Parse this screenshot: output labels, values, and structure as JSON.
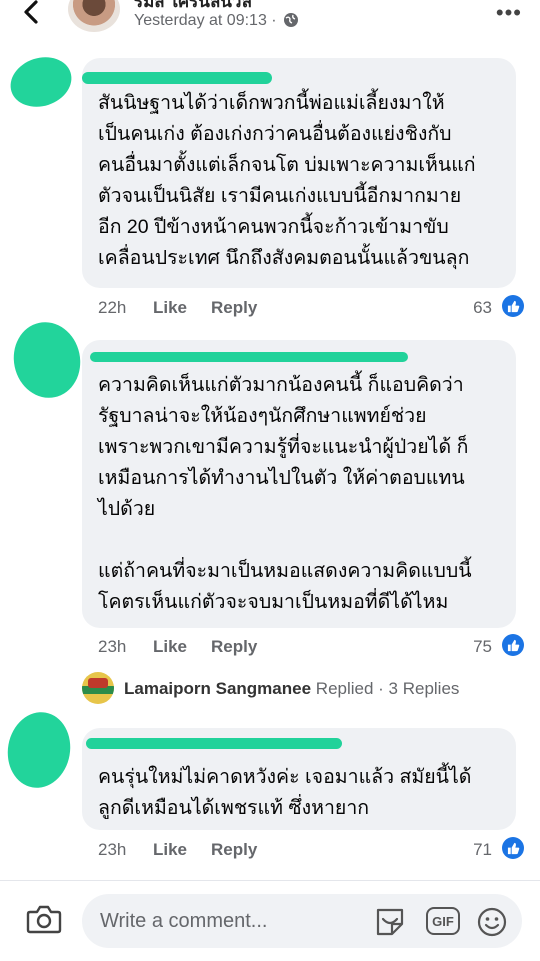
{
  "header": {
    "poster_name": "รมิส ใครนิลนัวล",
    "timestamp": "Yesterday at 09:13 ·",
    "more_label": "•••"
  },
  "comments": [
    {
      "text": "สันนิษฐานได้ว่าเด็กพวกนี้พ่อแม่เลี้ยงมาให้\nเป็นคนเก่ง ต้องเก่งกว่าคนอื่นต้องแย่งชิงกับ\nคนอื่นมาตั้งแต่เล็กจนโต บ่มเพาะความเห็นแก่\nตัวจนเป็นนิสัย เรามีคนเก่งแบบนี้อีกมากมาย\nอีก 20 ปีข้างหน้าคนพวกนี้จะก้าวเข้ามาขับ\nเคลื่อนประเทศ นึกถึงสังคมตอนนั้นแล้วขนลุก",
      "time": "22h",
      "like_label": "Like",
      "reply_label": "Reply",
      "reaction_count": "63"
    },
    {
      "text": "ความคิดเห็นแก่ตัวมากน้องคนนี้ ก็แอบคิดว่า\nรัฐบาลน่าจะให้น้องๆนักศึกษาแพทย์ช่วย\nเพราะพวกเขามีความรู้ที่จะแนะนำผู้ป่วยได้ ก็\nเหมือนการได้ทำงานไปในตัว ให้ค่าตอบแทน\nไปด้วย\n\nแต่ถ้าคนที่จะมาเป็นหมอแสดงความคิดแบบนี้\nโคตรเห็นแก่ตัวจะจบมาเป็นหมอที่ดีได้ไหม",
      "time": "23h",
      "like_label": "Like",
      "reply_label": "Reply",
      "reaction_count": "75"
    },
    {
      "text": "คนรุ่นใหม่ไม่คาดหวังค่ะ เจอมาแล้ว สมัยนี้ได้\nลูกดีเหมือนได้เพชรแท้ ซึ่งหายาก",
      "time": "23h",
      "like_label": "Like",
      "reply_label": "Reply",
      "reaction_count": "71"
    }
  ],
  "reply_summary": {
    "name": "Lamaiporn Sangmanee",
    "rest": " Replied · 3 Replies"
  },
  "composer": {
    "placeholder": "Write a comment...",
    "gif_label": "GIF"
  },
  "colors": {
    "like_blue": "#1b74e4",
    "redaction_green": "#22d49b",
    "bubble_gray": "#eff1f4"
  }
}
